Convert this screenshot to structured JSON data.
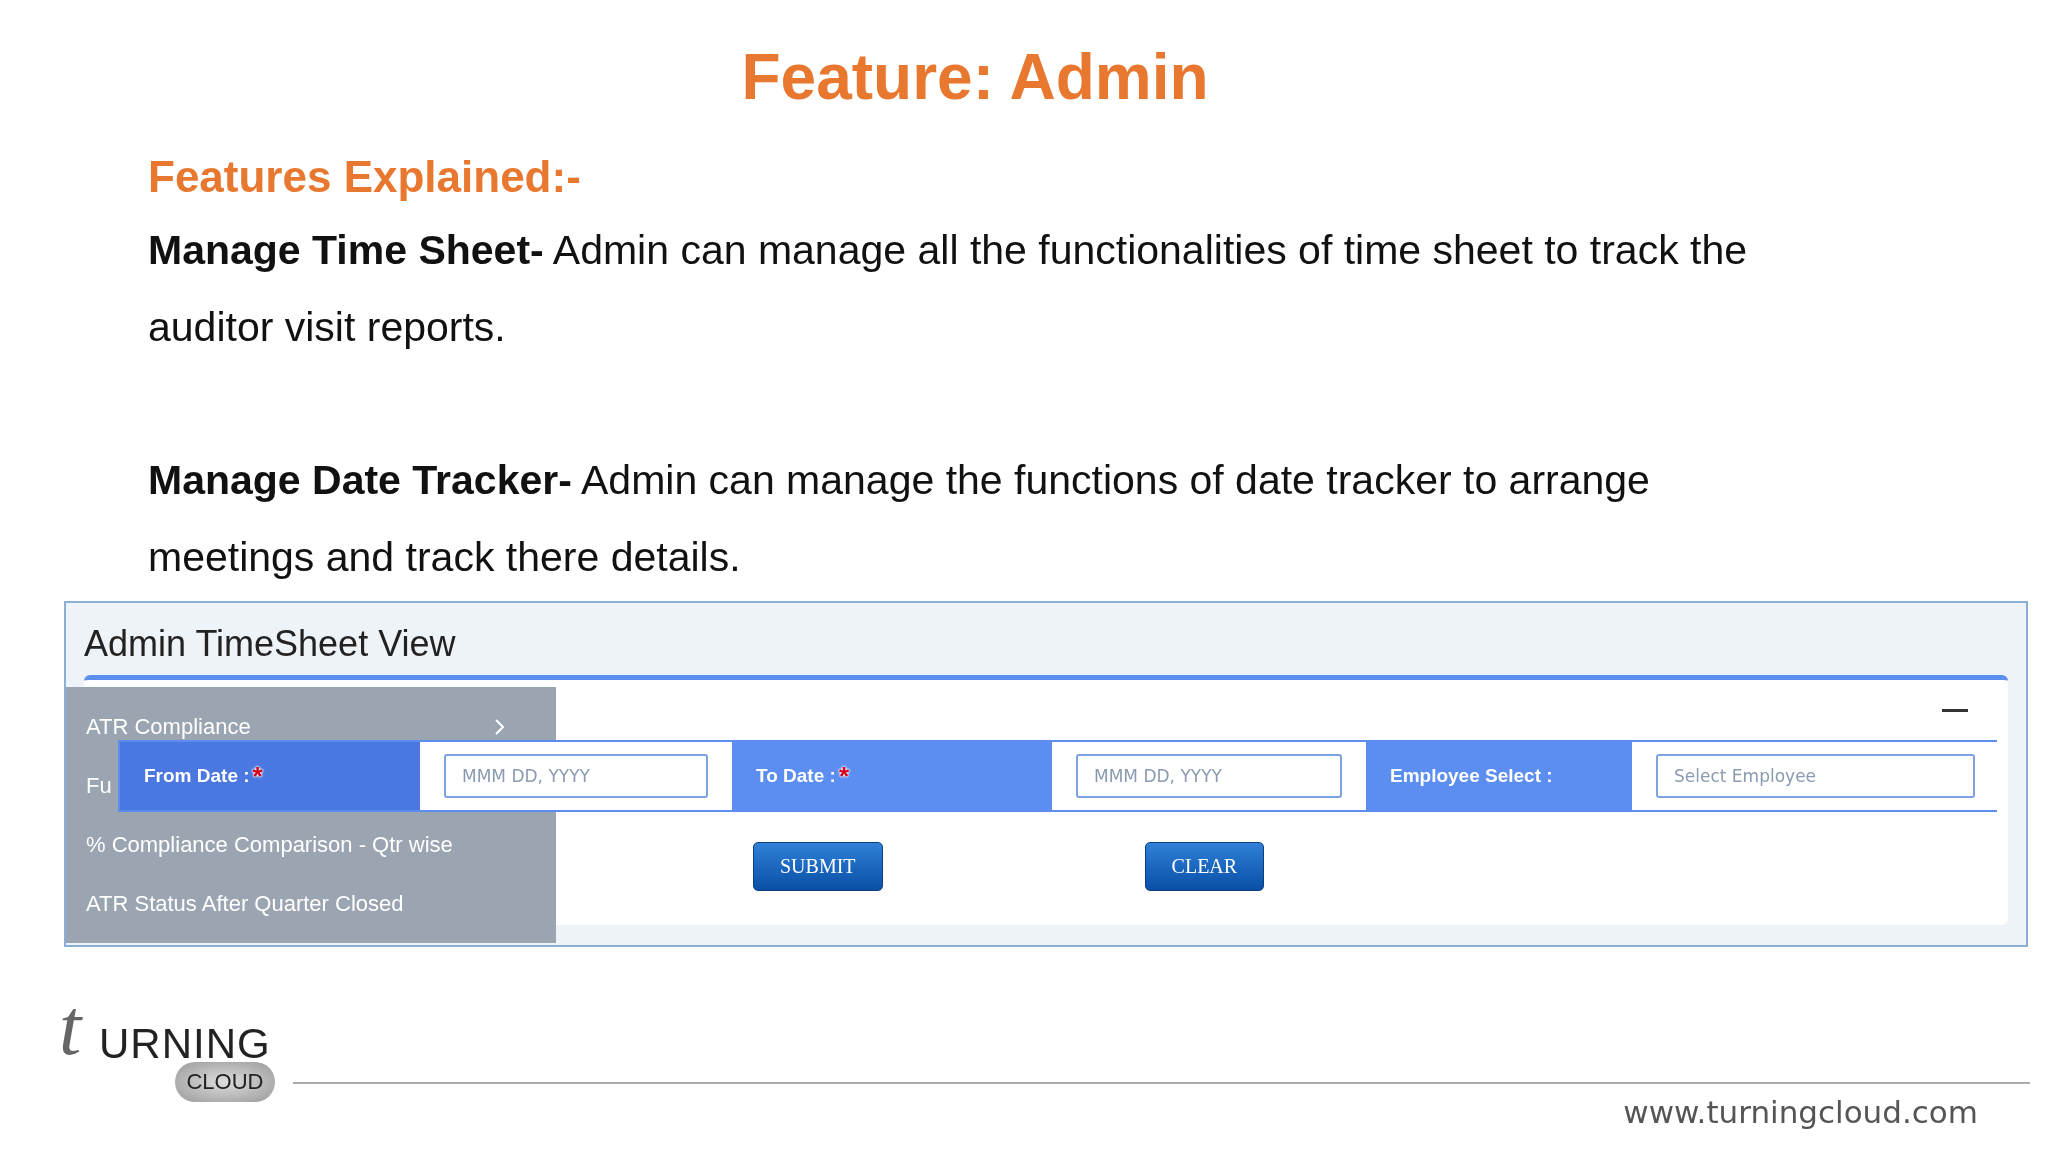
{
  "slide": {
    "title": "Feature: Admin",
    "subtitle": "Features Explained:-",
    "paragraphs": [
      {
        "lead": "Manage Time Sheet-",
        "text": "Admin can manage all the functionalities of time sheet  to track the auditor visit reports."
      },
      {
        "lead": "Manage Date Tracker-",
        "text": "Admin can manage the functions of date tracker to arrange meetings and track there details."
      }
    ]
  },
  "screenshot": {
    "title": "Admin TimeSheet View",
    "menu": [
      {
        "label": "ATR Compliance",
        "has_submenu": true
      },
      {
        "label": "Fu",
        "has_submenu": false
      },
      {
        "label": "% Compliance Comparison - Qtr wise",
        "has_submenu": false
      },
      {
        "label": "ATR Status After Quarter Closed",
        "has_submenu": false
      }
    ],
    "fields": [
      {
        "label": "From Date :",
        "required_mark": "*",
        "placeholder": "MMM DD, YYYY"
      },
      {
        "label": "To Date :",
        "required_mark": "*",
        "placeholder": "MMM DD, YYYY"
      },
      {
        "label": "Employee Select :",
        "placeholder": "Select Employee"
      }
    ],
    "buttons": [
      "SUBMIT",
      "CLEAR"
    ]
  },
  "footer": {
    "logo": {
      "letter": "t",
      "word": "URNING",
      "sub": "CLOUD"
    },
    "url": "www.turningcloud.com"
  }
}
